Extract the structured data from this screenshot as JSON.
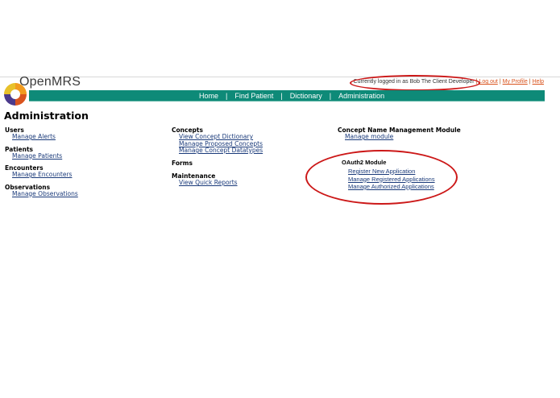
{
  "header": {
    "app_name": "OpenMRS",
    "logged_in_text": "Currently logged in as Bob The Client Developer",
    "logout_label": "Log out",
    "profile_label": "My Profile",
    "help_label": "Help"
  },
  "nav": {
    "items": [
      {
        "label": "Home"
      },
      {
        "label": "Find Patient"
      },
      {
        "label": "Dictionary"
      },
      {
        "label": "Administration"
      }
    ]
  },
  "page": {
    "title": "Administration"
  },
  "columns": {
    "col1": [
      {
        "title": "Users",
        "links": [
          "Manage Alerts"
        ]
      },
      {
        "title": "Patients",
        "links": [
          "Manage Patients"
        ]
      },
      {
        "title": "Encounters",
        "links": [
          "Manage Encounters"
        ]
      },
      {
        "title": "Observations",
        "links": [
          "Manage Observations"
        ]
      }
    ],
    "col2": [
      {
        "title": "Concepts",
        "links": [
          "View Concept Dictionary",
          "Manage Proposed Concepts",
          "Manage Concept Datatypes"
        ]
      },
      {
        "title": "Forms",
        "links": []
      },
      {
        "title": "Maintenance",
        "links": [
          "View Quick Reports"
        ]
      }
    ],
    "col3": [
      {
        "title": "Concept Name Management Module",
        "links": [
          "Manage module"
        ]
      }
    ]
  },
  "oauth": {
    "title": "OAuth2 Module",
    "links": [
      "Register New Application",
      "Manage Registered Applications",
      "Manage Authorized Applications"
    ]
  },
  "colors": {
    "nav_bg": "#0e8a78",
    "link": "#1a3a7a",
    "annotation": "#cc1818",
    "userbar_link": "#d9541e"
  }
}
